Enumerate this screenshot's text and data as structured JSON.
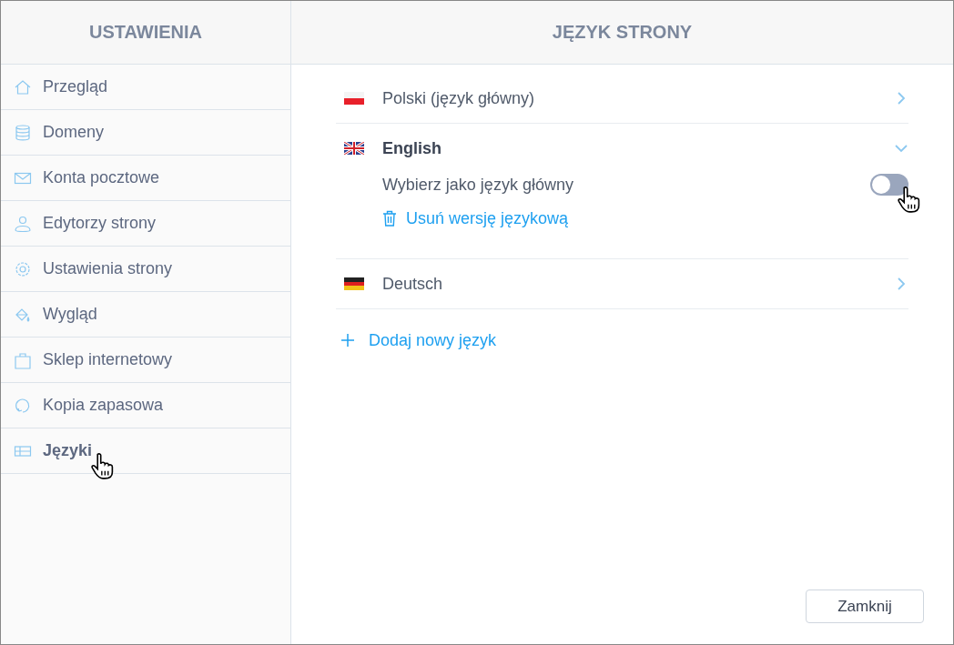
{
  "sidebar": {
    "title": "USTAWIENIA",
    "items": [
      {
        "label": "Przegląd",
        "selected": false
      },
      {
        "label": "Domeny",
        "selected": false
      },
      {
        "label": "Konta pocztowe",
        "selected": false
      },
      {
        "label": "Edytorzy strony",
        "selected": false
      },
      {
        "label": "Ustawienia strony",
        "selected": false
      },
      {
        "label": "Wygląd",
        "selected": false
      },
      {
        "label": "Sklep internetowy",
        "selected": false
      },
      {
        "label": "Kopia zapasowa",
        "selected": false
      },
      {
        "label": "Języki",
        "selected": true
      }
    ]
  },
  "main": {
    "title": "JĘZYK STRONY",
    "languages": [
      {
        "name": "Polski (język główny)",
        "expanded": false
      },
      {
        "name": "English",
        "expanded": true,
        "main_toggle": {
          "label": "Wybierz jako język główny",
          "on": false
        },
        "delete_link": "Usuń wersję językową"
      },
      {
        "name": "Deutsch",
        "expanded": false
      }
    ],
    "add_link": "Dodaj nowy język",
    "close_button": "Zamknij"
  }
}
